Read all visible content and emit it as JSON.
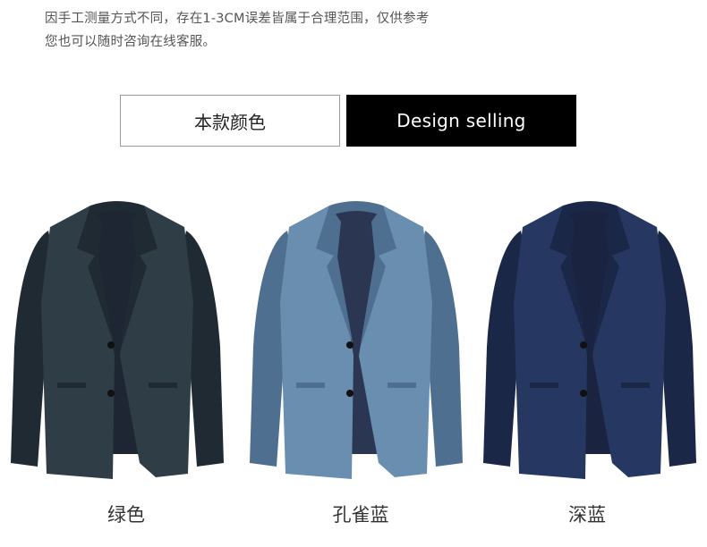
{
  "note": {
    "line1": "因手工测量方式不同，存在1-3CM误差皆属于合理范围，仅供参考",
    "line2": "您也可以随时咨询在线客服。"
  },
  "tabs": {
    "left_label": "本款颜色",
    "right_label": "Design selling"
  },
  "products": [
    {
      "color_name": "绿色",
      "fabric": "#2f3d47",
      "shade": "#1f2a33",
      "lining": "#1d2632"
    },
    {
      "color_name": "孔雀蓝",
      "fabric": "#6a8eb0",
      "shade": "#4e6f90",
      "lining": "#2a3652"
    },
    {
      "color_name": "深蓝",
      "fabric": "#263861",
      "shade": "#1a2747",
      "lining": "#1a2440"
    }
  ]
}
